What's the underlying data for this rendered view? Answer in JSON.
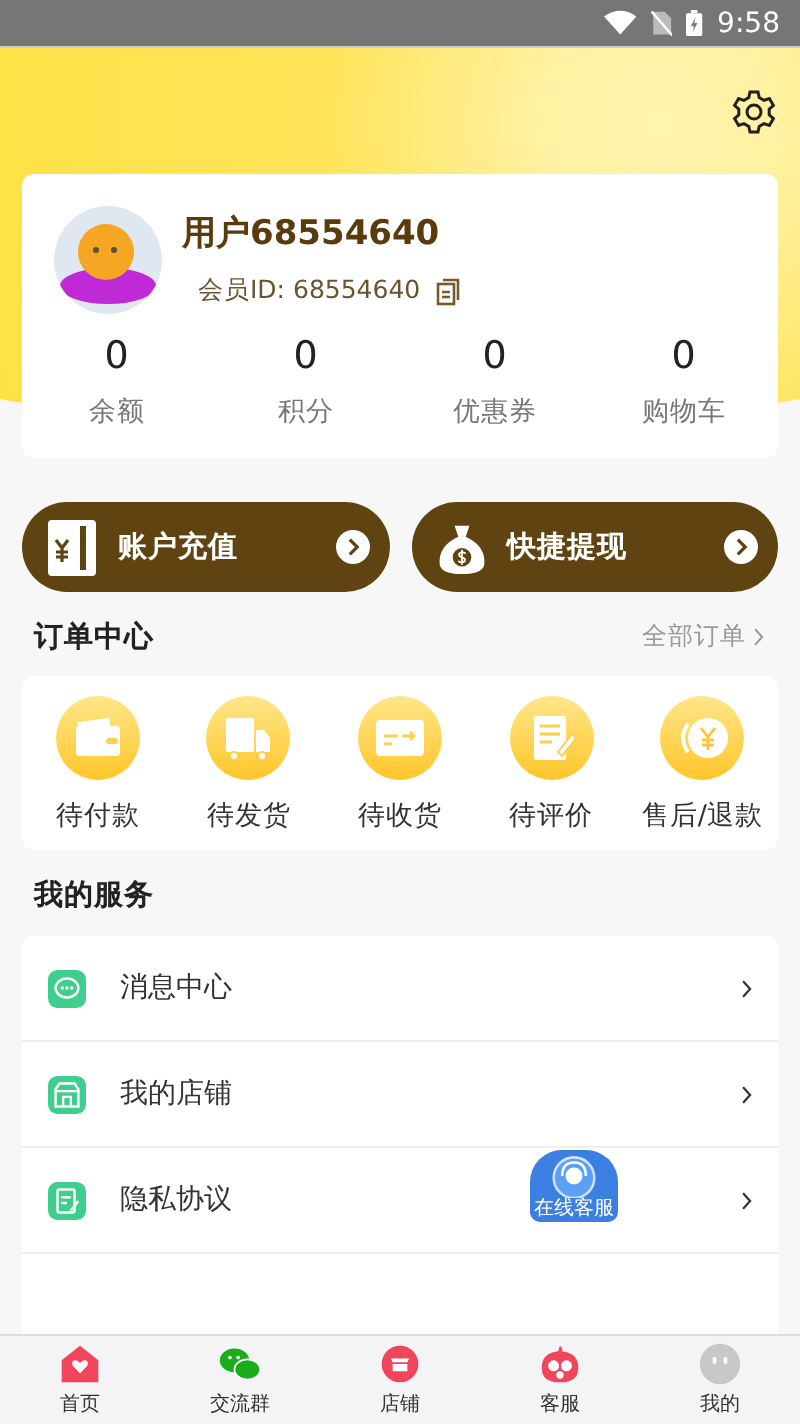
{
  "status_bar": {
    "time": "9:58"
  },
  "profile": {
    "username": "用户68554640",
    "member_id": "会员ID: 68554640"
  },
  "stats": [
    {
      "value": "0",
      "label": "余额"
    },
    {
      "value": "0",
      "label": "积分"
    },
    {
      "value": "0",
      "label": "优惠券"
    },
    {
      "value": "0",
      "label": "购物车"
    }
  ],
  "actions": [
    {
      "kind": "recharge",
      "label": "账户充值"
    },
    {
      "kind": "withdraw",
      "label": "快捷提现"
    }
  ],
  "orders": {
    "title": "订单中心",
    "link": "全部订单",
    "items": [
      {
        "kind": "wallet",
        "label": "待付款"
      },
      {
        "kind": "truck",
        "label": "待发货"
      },
      {
        "kind": "card",
        "label": "待收货"
      },
      {
        "kind": "note",
        "label": "待评价"
      },
      {
        "kind": "refund",
        "label": "售后/退款"
      }
    ]
  },
  "services": {
    "title": "我的服务",
    "items": [
      {
        "kind": "message",
        "label": "消息中心"
      },
      {
        "kind": "shop",
        "label": "我的店铺"
      },
      {
        "kind": "doc",
        "label": "隐私协议"
      }
    ]
  },
  "floating_badge": {
    "label": "在线客服"
  },
  "tabs": [
    {
      "kind": "home",
      "label": "首页"
    },
    {
      "kind": "chat",
      "label": "交流群"
    },
    {
      "kind": "store",
      "label": "店铺"
    },
    {
      "kind": "service",
      "label": "客服"
    },
    {
      "kind": "me",
      "label": "我的"
    }
  ]
}
